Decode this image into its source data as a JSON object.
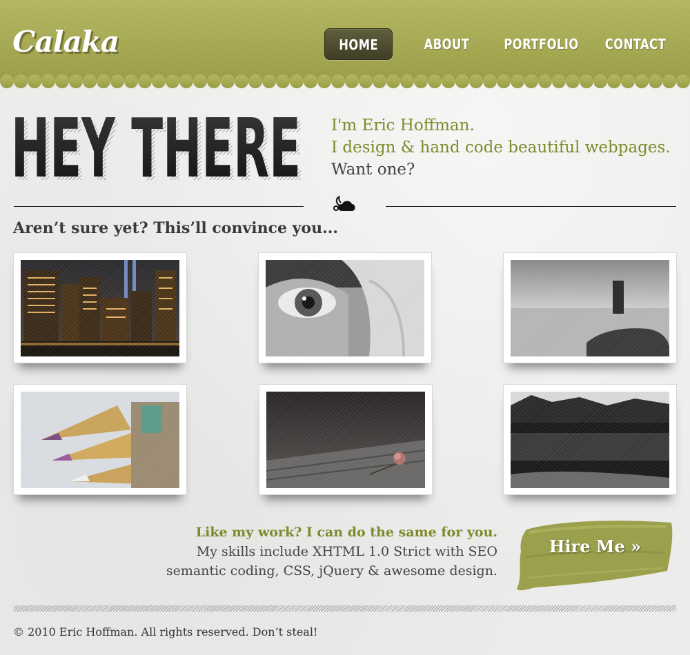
{
  "header": {
    "logo": "Calaka",
    "nav": [
      {
        "label": "HOME",
        "active": true
      },
      {
        "label": "ABOUT",
        "active": false
      },
      {
        "label": "PORTFOLIO",
        "active": false
      },
      {
        "label": "CONTACT",
        "active": false
      }
    ]
  },
  "hero": {
    "title": "HEY THERE",
    "intro": {
      "line1": "I'm Eric Hoffman.",
      "line2": "I design & hand code beautiful webpages.",
      "line3": "Want one?"
    }
  },
  "portfolio": {
    "heading": "Aren’t sure yet? This’ll convince you...",
    "items": [
      {
        "subject": "city skyline at night"
      },
      {
        "subject": "close-up eye"
      },
      {
        "subject": "rock pillar in sea"
      },
      {
        "subject": "colored pencils"
      },
      {
        "subject": "rose on wooden table"
      },
      {
        "subject": "lake with mountains"
      }
    ]
  },
  "hire": {
    "headline": "Like my work? I can do the same for you.",
    "line1": "My skills include XHTML 1.0 Strict with SEO",
    "line2": "semantic coding, CSS, jQuery & awesome design.",
    "button_label": "Hire Me »"
  },
  "footer": {
    "copyright": "© 2010 Eric Hoffman. All rights reserved. Don’t steal!"
  },
  "colors": {
    "header_olive": "#a3a64f",
    "accent_green": "#7f8a2d",
    "nav_active": "#4a4930",
    "brush_green": "#9aa04c"
  }
}
